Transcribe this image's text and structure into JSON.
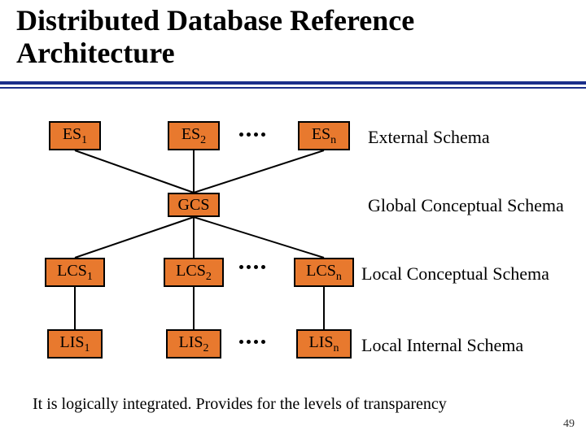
{
  "title": "Distributed Database Reference\nArchitecture",
  "rows": {
    "es": {
      "b1_base": "ES",
      "b1_sub": "1",
      "b2_base": "ES",
      "b2_sub": "2",
      "bn_base": "ES",
      "bn_sub": "n",
      "label": "External Schema"
    },
    "gcs": {
      "b_base": "GCS",
      "label": "Global Conceptual Schema"
    },
    "lcs": {
      "b1_base": "LCS",
      "b1_sub": "1",
      "b2_base": "LCS",
      "b2_sub": "2",
      "bn_base": "LCS",
      "bn_sub": "n",
      "label": "Local Conceptual Schema"
    },
    "lis": {
      "b1_base": "LIS",
      "b1_sub": "1",
      "b2_base": "LIS",
      "b2_sub": "2",
      "bn_base": "LIS",
      "bn_sub": "n",
      "label": "Local Internal Schema"
    }
  },
  "caption": "It is logically integrated. Provides for the levels of transparency",
  "page_number": "49",
  "colors": {
    "box_fill": "#e8792e",
    "rule": "#1a2e8a"
  }
}
